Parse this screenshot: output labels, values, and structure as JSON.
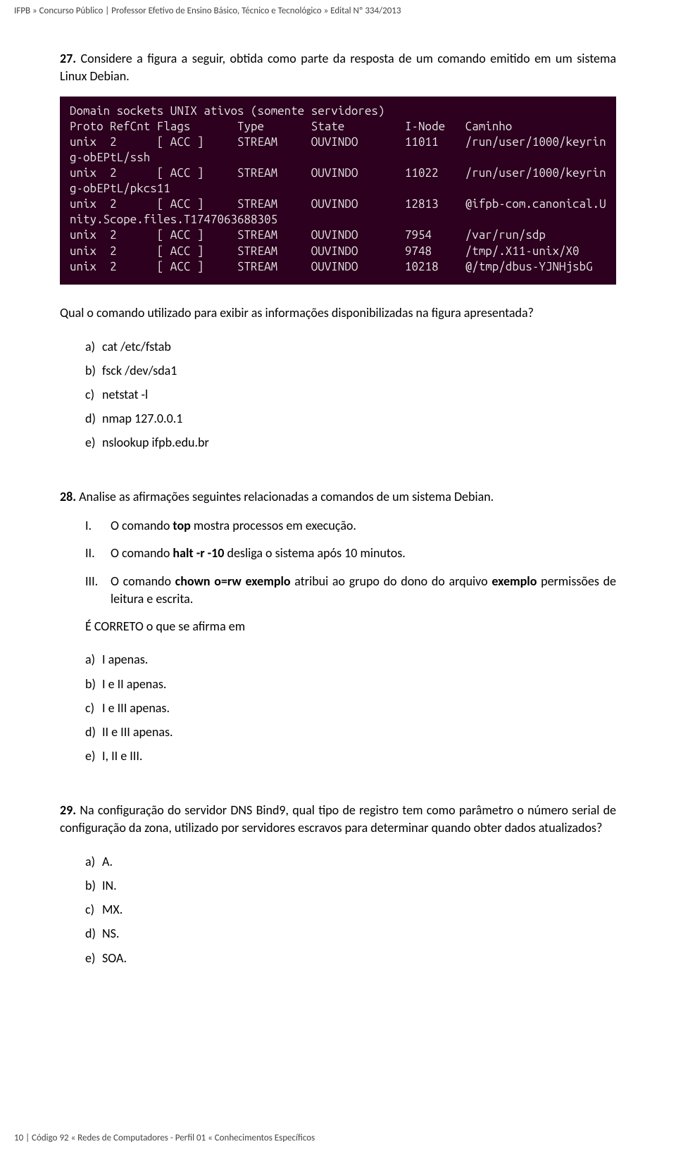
{
  "header": "IFPB  »  Concurso Público | Professor Efetivo de Ensino Básico, Técnico e Tecnológico »  Edital Nº 334/2013",
  "footer": "10 | Código 92  « Redes de Computadores - Perfil 01  « Conhecimentos Específicos",
  "q27": {
    "num": "27.",
    "text": "Considere a figura a seguir, obtida como parte da resposta de um comando emitido em um sistema Linux Debian.",
    "terminal": "Domain sockets UNIX ativos (somente servidores)\nProto RefCnt Flags       Type       State         I-Node   Caminho\nunix  2      [ ACC ]     STREAM     OUVINDO       11011    /run/user/1000/keyrin\ng-obEPtL/ssh\nunix  2      [ ACC ]     STREAM     OUVINDO       11022    /run/user/1000/keyrin\ng-obEPtL/pkcs11\nunix  2      [ ACC ]     STREAM     OUVINDO       12813    @ifpb-com.canonical.U\nnity.Scope.files.T1747063688305\nunix  2      [ ACC ]     STREAM     OUVINDO       7954     /var/run/sdp\nunix  2      [ ACC ]     STREAM     OUVINDO       9748     /tmp/.X11-unix/X0\nunix  2      [ ACC ]     STREAM     OUVINDO       10218    @/tmp/dbus-YJNHjsbG",
    "prompt": "Qual o comando utilizado para exibir as informações disponibilizadas na figura apresentada?",
    "opts": {
      "a": {
        "l": "a)",
        "t": "cat /etc/fstab"
      },
      "b": {
        "l": "b)",
        "t": "fsck /dev/sda1"
      },
      "c": {
        "l": "c)",
        "t": "netstat -l"
      },
      "d": {
        "l": "d)",
        "t": "nmap 127.0.0.1"
      },
      "e": {
        "l": "e)",
        "t": "nslookup ifpb.edu.br"
      }
    }
  },
  "q28": {
    "num": "28.",
    "text": "Analise as afirmações seguintes relacionadas a comandos de um sistema Debian.",
    "roman": {
      "i": {
        "l": "I.",
        "pre": "O comando ",
        "b1": "top",
        "post": " mostra processos em execução."
      },
      "ii": {
        "l": "II.",
        "pre": "O comando ",
        "b1": "halt  -r -10",
        "post": "  desliga o sistema após 10 minutos."
      },
      "iii": {
        "l": "III.",
        "pre": "O comando ",
        "b1": "chown o=rw exemplo",
        "mid": " atribui ao grupo do dono do arquivo ",
        "b2": "exemplo",
        "post": " permissões de leitura e escrita."
      }
    },
    "prompt": "É CORRETO o que se afirma em",
    "opts": {
      "a": {
        "l": "a)",
        "t": "I apenas."
      },
      "b": {
        "l": "b)",
        "t": "I e II apenas."
      },
      "c": {
        "l": "c)",
        "t": "I e III apenas."
      },
      "d": {
        "l": "d)",
        "t": "II e III apenas."
      },
      "e": {
        "l": "e)",
        "t": "I, II e III."
      }
    }
  },
  "q29": {
    "num": "29.",
    "text": "Na configuração do servidor DNS Bind9, qual tipo de registro tem como parâmetro o número serial de configuração da zona, utilizado por servidores escravos para determinar quando obter dados atualizados?",
    "opts": {
      "a": {
        "l": "a)",
        "t": "A."
      },
      "b": {
        "l": "b)",
        "t": "IN."
      },
      "c": {
        "l": "c)",
        "t": "MX."
      },
      "d": {
        "l": "d)",
        "t": "NS."
      },
      "e": {
        "l": "e)",
        "t": "SOA."
      }
    }
  }
}
